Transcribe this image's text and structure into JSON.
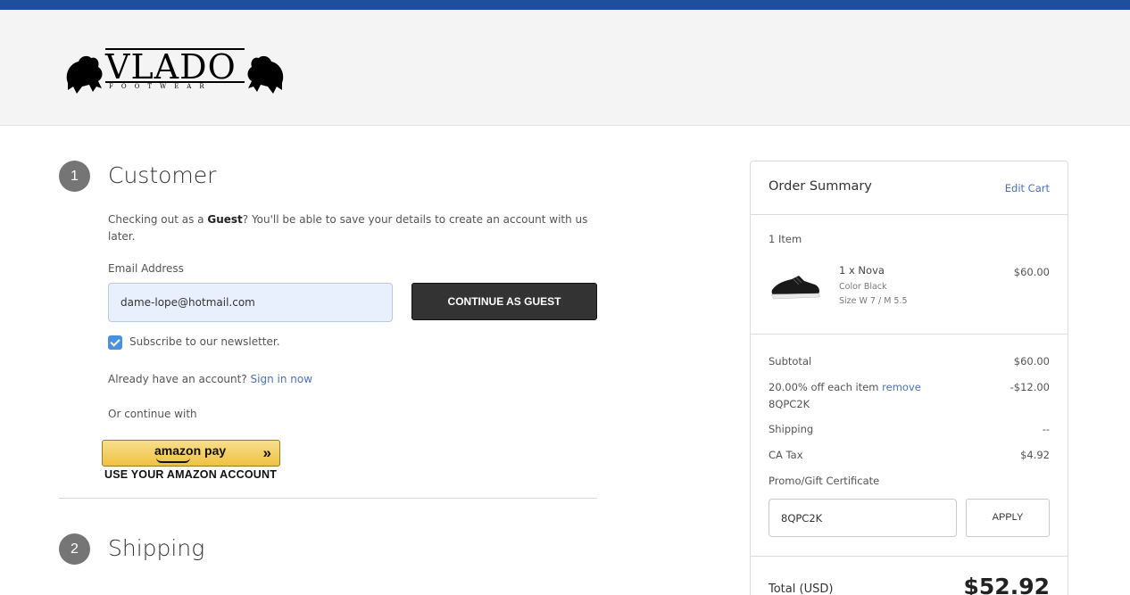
{
  "brand": {
    "name": "VLADO",
    "tagline": "FOOTWEAR"
  },
  "customer": {
    "step_number": "1",
    "title": "Customer",
    "guest_text_before": "Checking out as a ",
    "guest_text_bold": "Guest",
    "guest_text_after": "? You'll be able to save your details to create an account with us later.",
    "email_label": "Email Address",
    "email_value": "dame-lope@hotmail.com",
    "continue_button": "CONTINUE AS GUEST",
    "newsletter_label": "Subscribe to our newsletter.",
    "newsletter_checked": true,
    "account_prompt": "Already have an account?",
    "sign_in_link": "Sign in now",
    "continue_with": "Or continue with",
    "amazon_pay_label": "amazon pay",
    "amazon_caption": "USE YOUR AMAZON ACCOUNT"
  },
  "shipping": {
    "step_number": "2",
    "title": "Shipping"
  },
  "order_summary": {
    "title": "Order Summary",
    "edit_cart": "Edit Cart",
    "item_count": "1 Item",
    "item": {
      "name": "1 x Nova",
      "color": "Color Black",
      "size": "Size W 7 / M 5.5",
      "price": "$60.00"
    },
    "subtotal_label": "Subtotal",
    "subtotal_value": "$60.00",
    "discount_label": "20.00% off each item",
    "discount_remove": "remove",
    "discount_code": "8QPC2K",
    "discount_value": "-$12.00",
    "shipping_label": "Shipping",
    "shipping_value": "--",
    "tax_label": "CA Tax",
    "tax_value": "$4.92",
    "promo_label": "Promo/Gift Certificate",
    "promo_value": "8QPC2K",
    "apply_button": "APPLY",
    "total_label": "Total (USD)",
    "total_value": "$52.92"
  },
  "colors": {
    "topbar": "#1d4f9c",
    "link": "#4b71b8",
    "button_dark": "#333333",
    "checkbox": "#4a90e2",
    "amazon_gold": "#efc13f"
  },
  "icons": {
    "logo_left": "lion-rampant-icon",
    "logo_right": "lion-rampant-icon",
    "checkbox": "checkmark-icon",
    "amazon": "double-chevron-icon",
    "product": "sneaker-thumbnail"
  }
}
